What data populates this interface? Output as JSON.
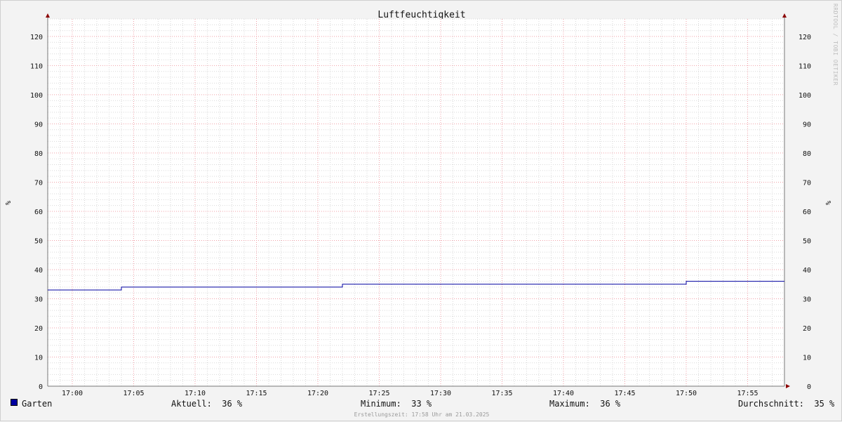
{
  "chart_data": {
    "type": "line",
    "title": "Luftfeuchtigkeit",
    "ylabel": "%",
    "ylabel_right": "%",
    "ylim": [
      0,
      126
    ],
    "xlim": [
      "16:58",
      "17:58"
    ],
    "y_ticks": [
      0,
      10,
      20,
      30,
      40,
      50,
      60,
      70,
      80,
      90,
      100,
      110,
      120
    ],
    "x_ticks": [
      "17:00",
      "17:05",
      "17:10",
      "17:15",
      "17:20",
      "17:25",
      "17:30",
      "17:35",
      "17:40",
      "17:45",
      "17:50",
      "17:55"
    ],
    "grid": true,
    "series": [
      {
        "name": "Garten",
        "color": "#0000a0",
        "points": [
          {
            "x": "16:58",
            "y": 33
          },
          {
            "x": "17:04",
            "y": 33
          },
          {
            "x": "17:04",
            "y": 34
          },
          {
            "x": "17:22",
            "y": 34
          },
          {
            "x": "17:22",
            "y": 35
          },
          {
            "x": "17:50",
            "y": 35
          },
          {
            "x": "17:50",
            "y": 36
          },
          {
            "x": "17:58",
            "y": 36
          }
        ]
      }
    ],
    "watermark": "RRDTOOL / TOBI OETIKER"
  },
  "legend": {
    "series_name": "Garten",
    "color": "#0000a0",
    "current": "Aktuell:  36 %",
    "minimum": "Minimum:  33 %",
    "maximum": "Maximum:  36 %",
    "average": "Durchschnitt:  35 %"
  },
  "footer": "Erstellungszeit: 17:58 Uhr am 21.03.2025"
}
